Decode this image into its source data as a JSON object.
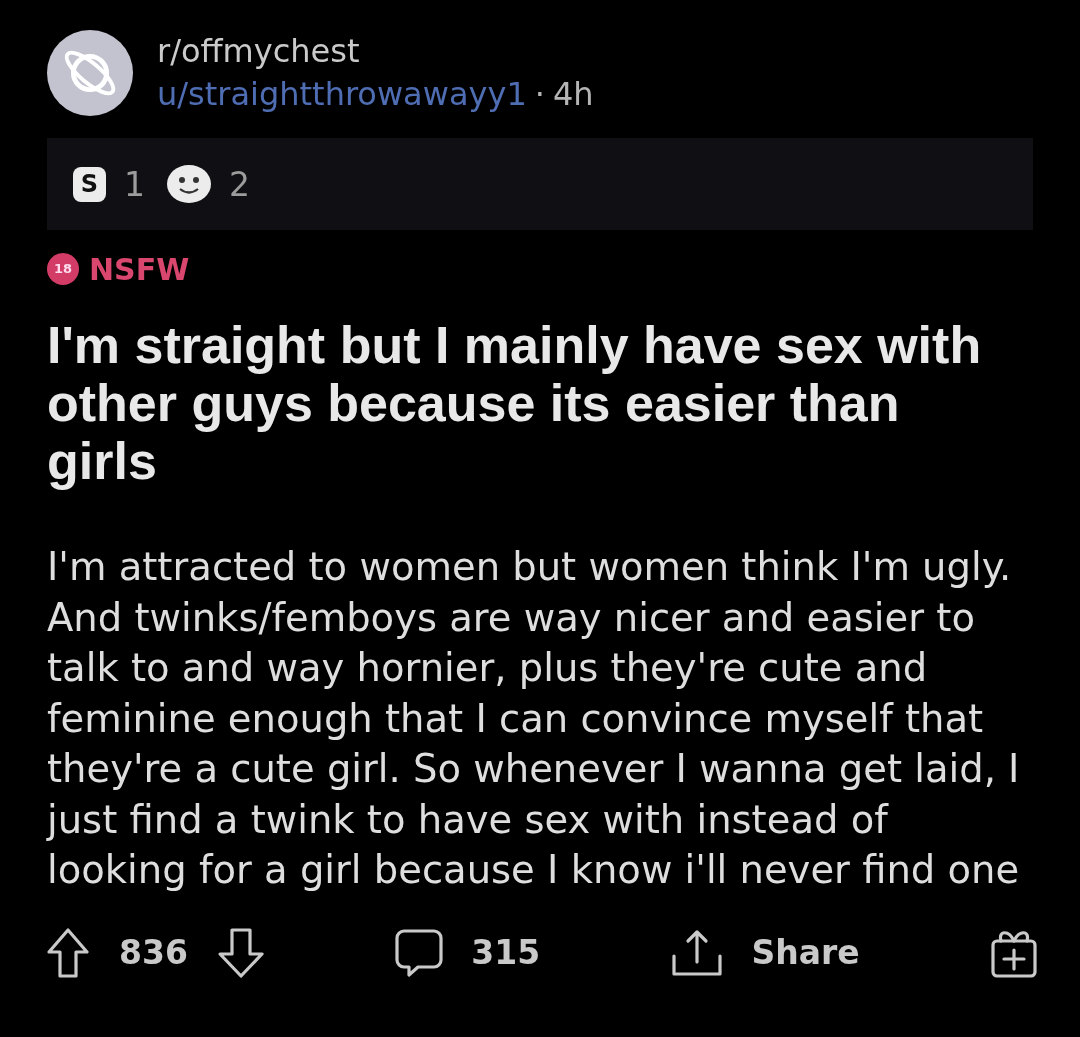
{
  "header": {
    "subreddit": "r/offmychest",
    "author": "u/straightthrowawayy1",
    "separator": "·",
    "age": "4h"
  },
  "awards": [
    {
      "kind": "letter",
      "symbol": "S",
      "count": "1"
    },
    {
      "kind": "face",
      "count": "2"
    }
  ],
  "flair": {
    "badge": "18",
    "label": "NSFW"
  },
  "title_lines": [
    "I'm straight but I mainly have sex with",
    "other guys because its easier than",
    "girls"
  ],
  "body_lines": [
    "I'm attracted to women but women think I'm ugly.",
    "And twinks/femboys are way nicer and easier to",
    "talk to and way hornier, plus they're cute and",
    "feminine enough that I can convince myself that",
    "they're a cute girl. So whenever I wanna get laid, I",
    "just find a twink to have sex with instead of",
    "looking for a girl because I know i'll never find one"
  ],
  "actions": {
    "score": "836",
    "comments": "315",
    "share": "Share"
  }
}
